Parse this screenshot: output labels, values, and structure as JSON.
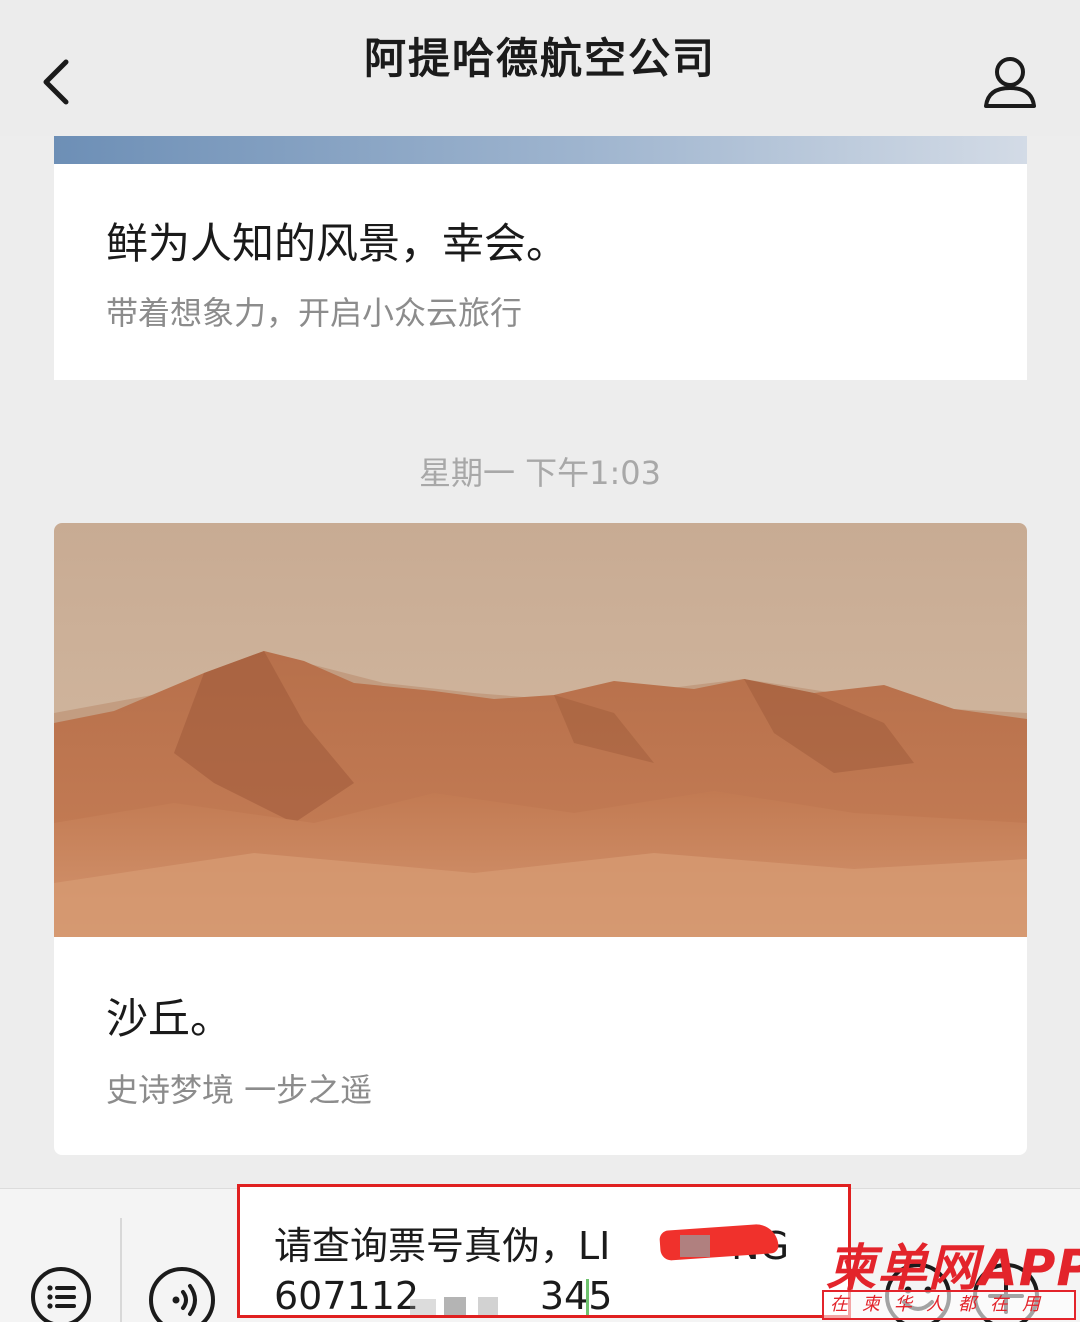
{
  "header": {
    "title": "阿提哈德航空公司"
  },
  "articles": [
    {
      "title": "鲜为人知的风景，幸会。",
      "subtitle": "带着想象力，开启小众云旅行"
    },
    {
      "title": "沙丘。",
      "subtitle": "史诗梦境 一步之遥"
    }
  ],
  "timestamp": "星期一 下午1:03",
  "input": {
    "value": "请查询票号真伪，LI          NG\n607112          345"
  },
  "watermark": {
    "brand": "柬单网APP",
    "slogan": "在柬华人都在用"
  },
  "icons": {
    "back": "chevron-left-icon",
    "profile": "person-icon",
    "menu": "menu-icon",
    "voice": "voice-icon",
    "emoji": "emoji-icon",
    "plus": "plus-icon"
  },
  "colors": {
    "accent_red": "#e02020",
    "background": "#ededed"
  }
}
